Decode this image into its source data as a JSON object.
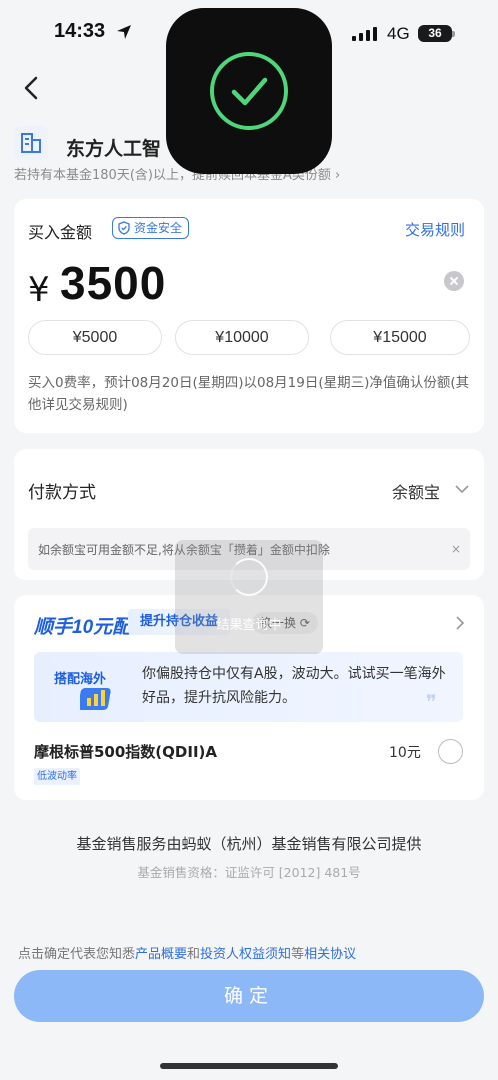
{
  "status_bar": {
    "time": "14:33",
    "network": "4G",
    "battery": "36"
  },
  "header": {
    "fund_name": "东方人工智",
    "hold_tip": "若持有本基金180天(含)以上，",
    "hold_tip_tail": "提前赎回本基金A类份额"
  },
  "buy": {
    "title": "买入金额",
    "safe_badge": "资金安全",
    "rules_link": "交易规则",
    "currency": "¥",
    "amount": "3500",
    "quick_amounts": [
      "¥5000",
      "¥10000",
      "¥15000"
    ],
    "fee_note": "买入0费率，预计08月20日(星期四)以08月19日(星期三)净值确认份额(其他详见交易规则)"
  },
  "payment": {
    "label": "付款方式",
    "method": "余额宝",
    "tip": "如余额宝可用金额不足,将从余额宝「攒着」金额中扣除",
    "tip_close": "×"
  },
  "recommend": {
    "brand": "顺手10元配",
    "boost_tag": "提升持仓收益",
    "swap": "换一换",
    "banner_tag": "搭配海外",
    "banner_text": "你偏股持仓中仅有A股，波动大。试试买一笔海外好品，提升抗风险能力。",
    "fund_name": "摩根标普500指数(QDII)A",
    "fund_amount": "10元",
    "fund_tag": "低波动率"
  },
  "loading": {
    "text": "结果查询中"
  },
  "footer": {
    "provider": "基金销售服务由蚂蚁（杭州）基金销售有限公司提供",
    "license": "基金销售资格：证监许可 [2012] 481号",
    "agree_prefix": "点击确定代表您知悉",
    "agree_link1": "产品概要",
    "agree_and": "和",
    "agree_link2": "投资人权益须知",
    "agree_mid": "等",
    "agree_link3": "相关协议",
    "confirm": "确定"
  },
  "icons": [
    "location-arrow-icon",
    "signal-icon",
    "battery-icon",
    "back-icon",
    "fund-logo-icon",
    "checkmark-icon",
    "shield-icon",
    "clear-icon",
    "chevron-down-icon",
    "chevron-right-icon",
    "refresh-icon",
    "spinner-icon",
    "close-icon",
    "quote-icon"
  ],
  "colors": {
    "accent": "#2f6fe3",
    "confirm_button": "#8cb8f7",
    "background": "#f4f5f7",
    "toast": "#0e0e0e",
    "check": "#4fd67a"
  }
}
